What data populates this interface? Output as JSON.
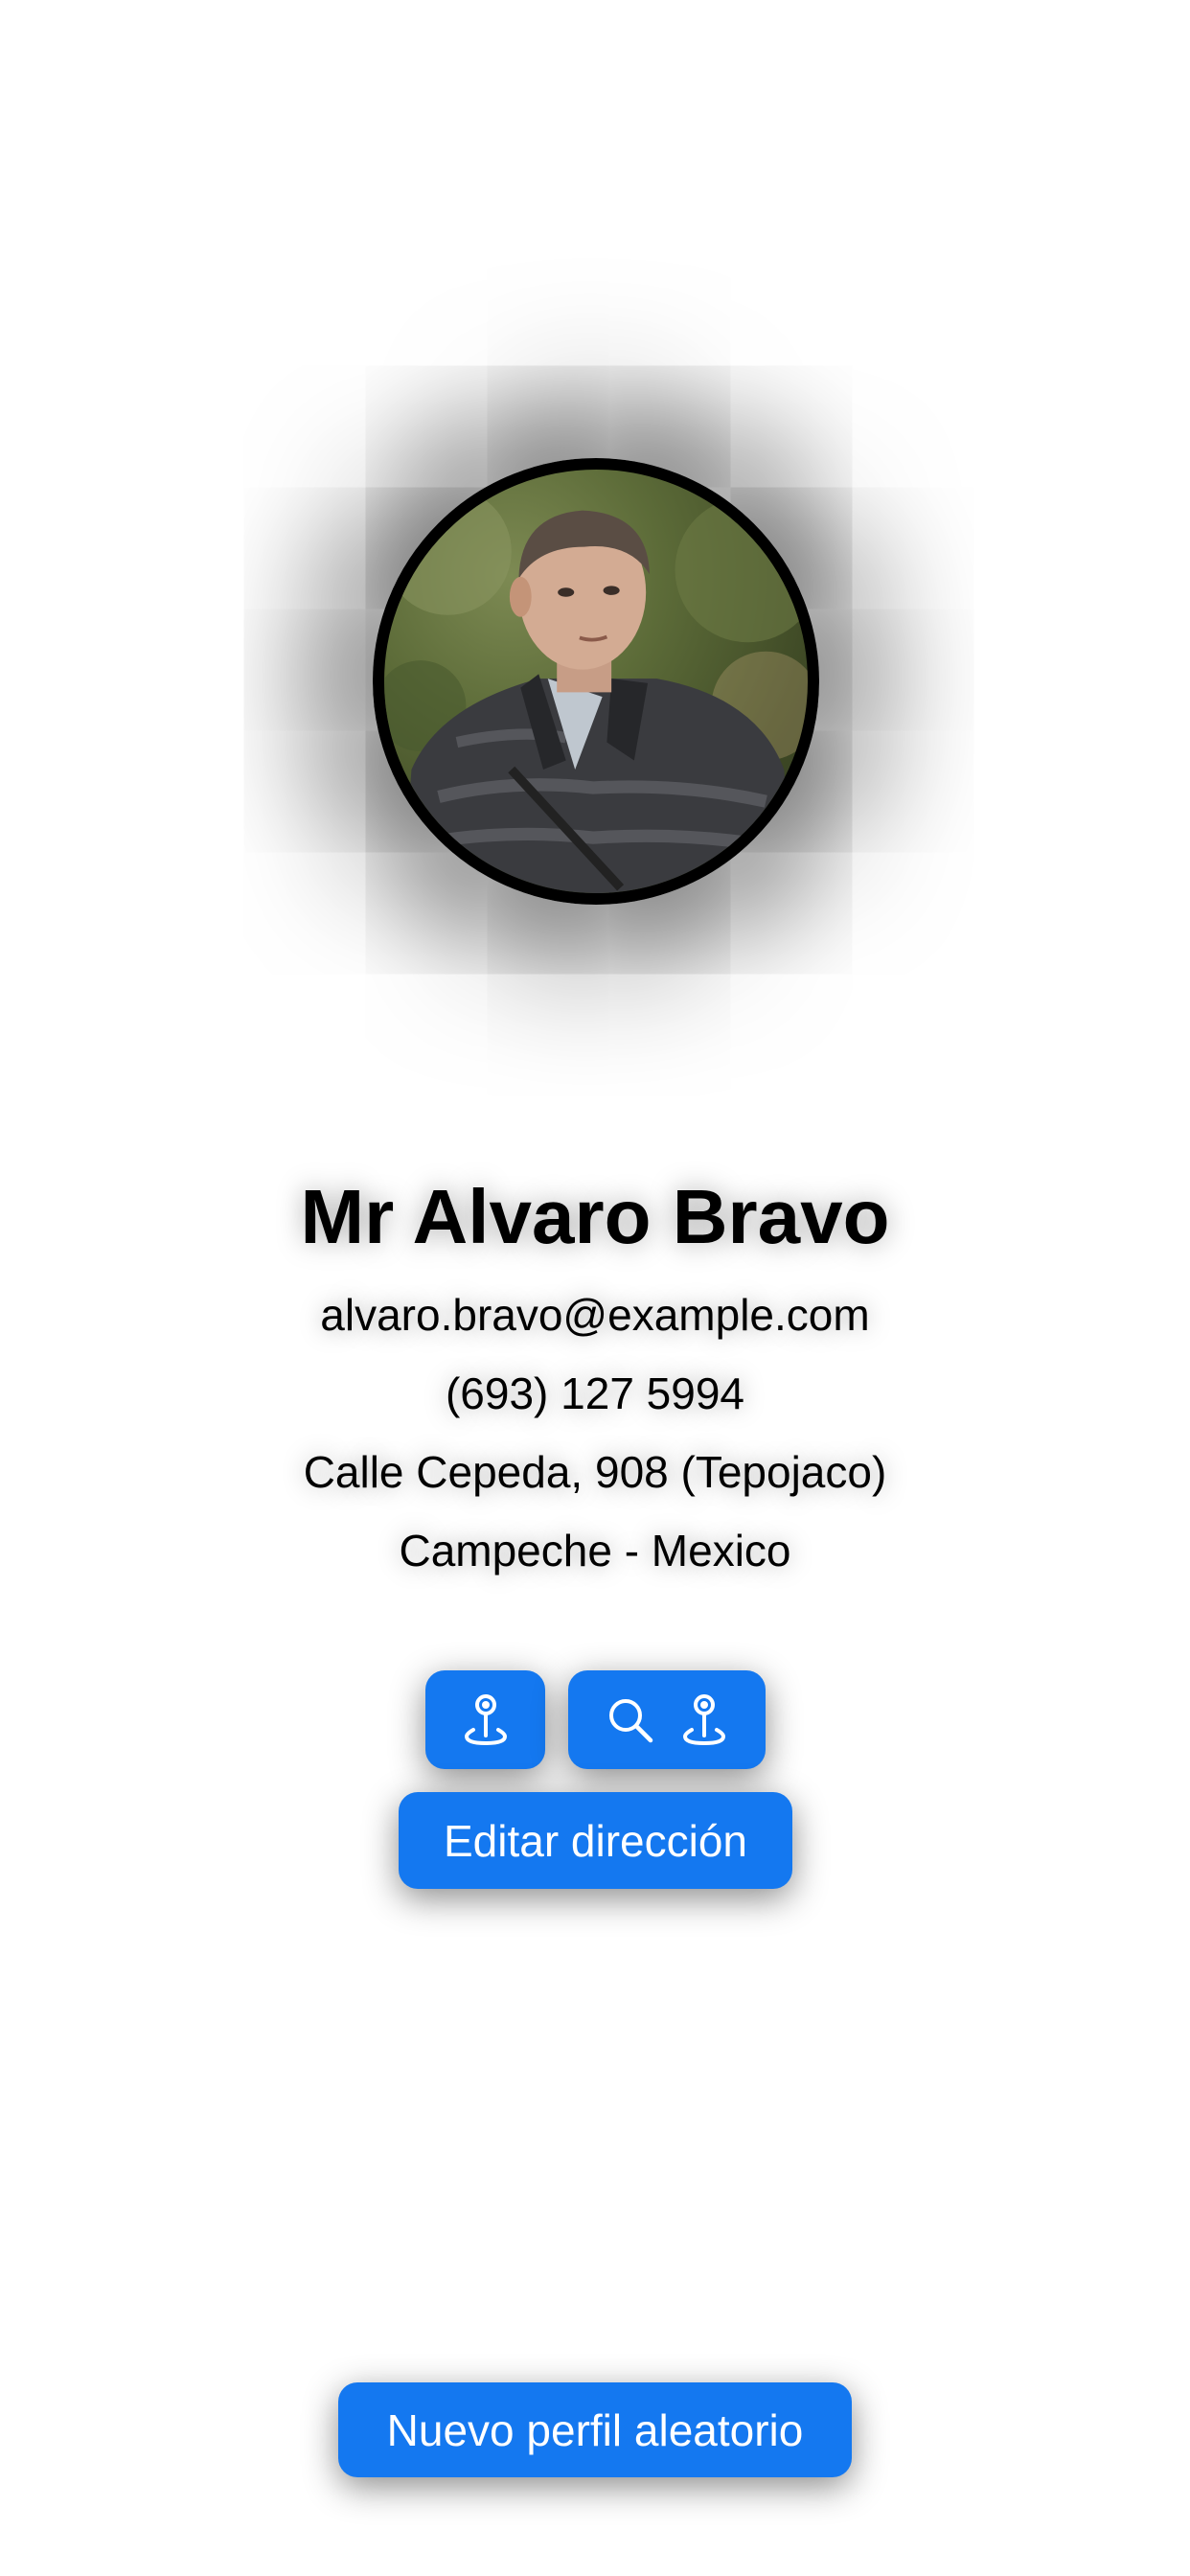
{
  "profile": {
    "name": "Mr Alvaro Bravo",
    "email": "alvaro.bravo@example.com",
    "phone": "(693) 127 5994",
    "street": "Calle Cepeda, 908 (Tepojaco)",
    "city_country": "Campeche - Mexico"
  },
  "actions": {
    "pin_icon": "map-pin-icon",
    "search_icon": "magnifying-glass-icon",
    "edit_address_label": "Editar dirección",
    "new_profile_label": "Nuevo perfil aleatorio"
  },
  "colors": {
    "button_bg": "#1478f0",
    "button_text": "#ffffff",
    "avatar_border": "#000000"
  }
}
